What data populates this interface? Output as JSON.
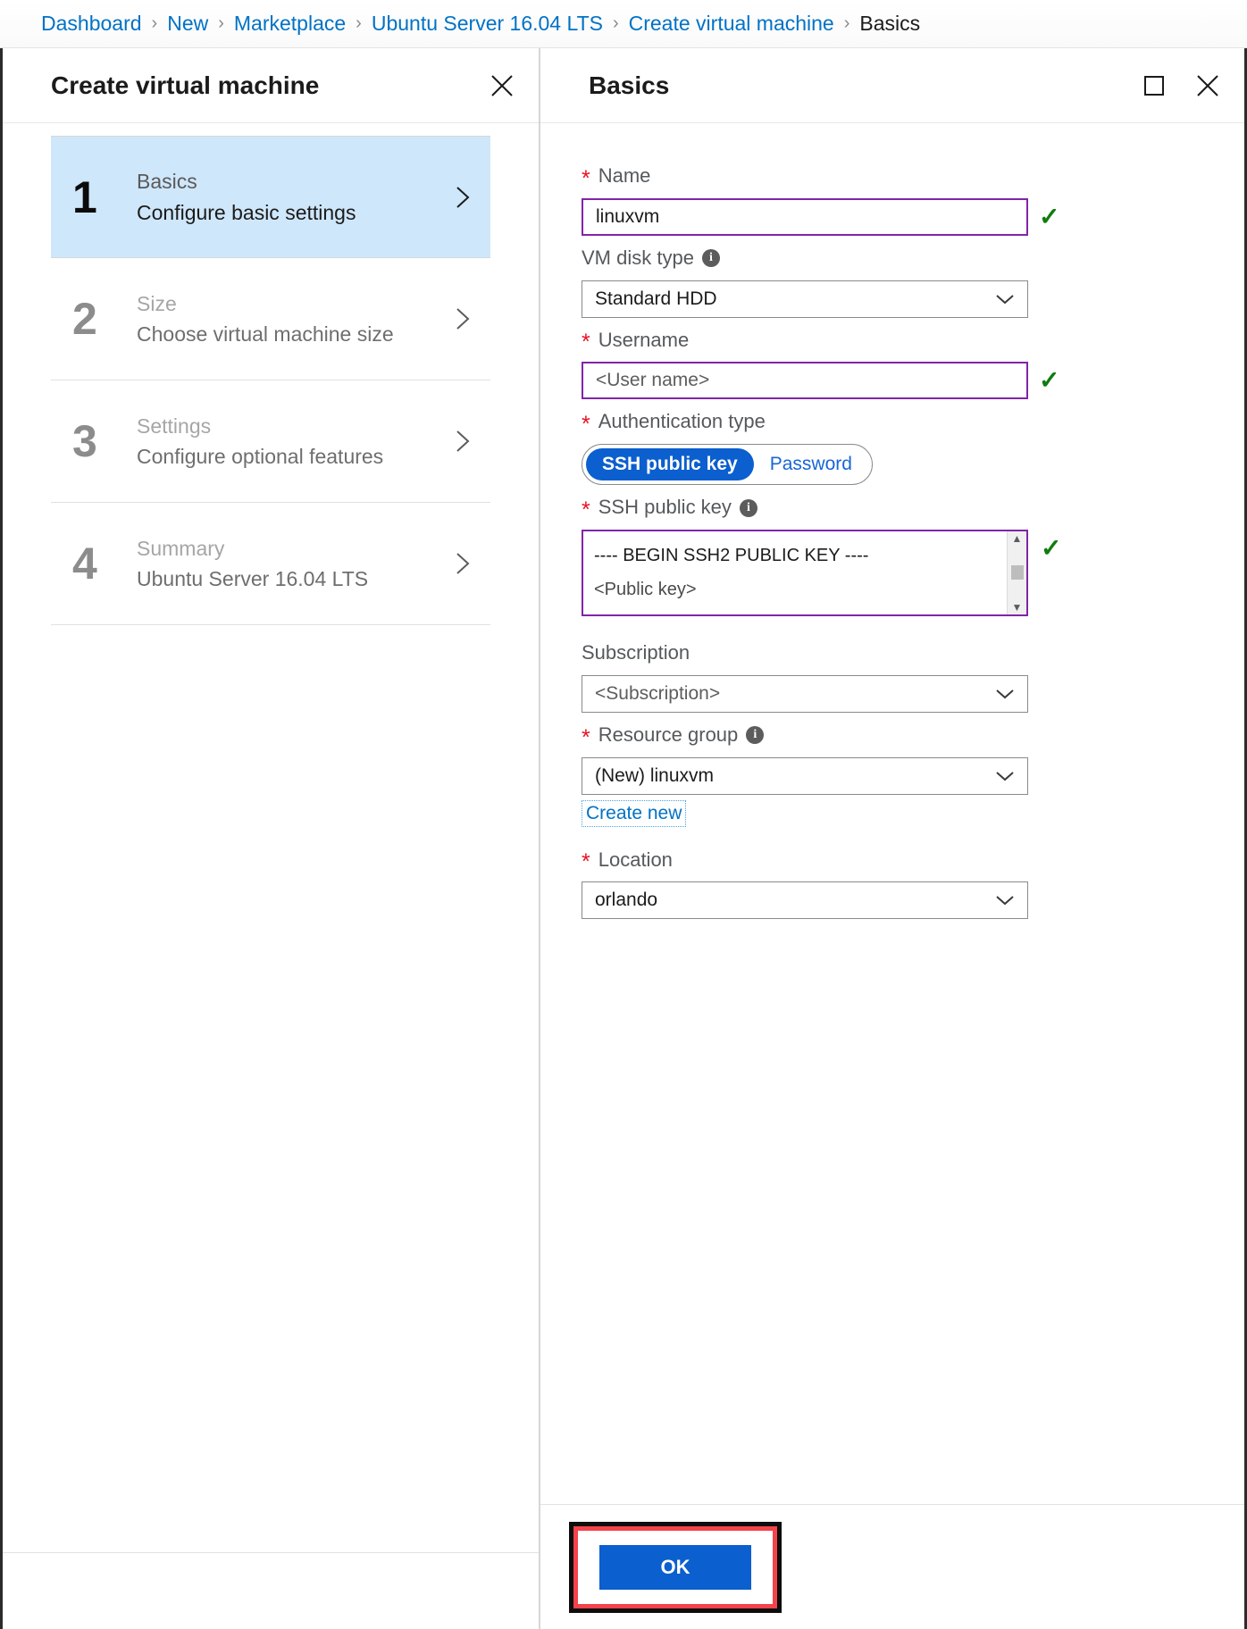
{
  "breadcrumb": {
    "items": [
      {
        "label": "Dashboard",
        "current": false
      },
      {
        "label": "New",
        "current": false
      },
      {
        "label": "Marketplace",
        "current": false
      },
      {
        "label": "Ubuntu Server 16.04 LTS",
        "current": false
      },
      {
        "label": "Create virtual machine",
        "current": false
      },
      {
        "label": "Basics",
        "current": true
      }
    ],
    "separator": "›"
  },
  "left_blade": {
    "title": "Create virtual machine",
    "close_icon": "close-icon",
    "steps": [
      {
        "number": "1",
        "name": "Basics",
        "desc": "Configure basic settings",
        "active": true
      },
      {
        "number": "2",
        "name": "Size",
        "desc": "Choose virtual machine size",
        "active": false
      },
      {
        "number": "3",
        "name": "Settings",
        "desc": "Configure optional features",
        "active": false
      },
      {
        "number": "4",
        "name": "Summary",
        "desc": "Ubuntu Server 16.04 LTS",
        "active": false
      }
    ]
  },
  "right_blade": {
    "title": "Basics",
    "maximize_icon": "maximize-icon",
    "close_icon": "close-icon",
    "fields": {
      "name": {
        "label": "Name",
        "required": true,
        "value": "linuxvm",
        "valid": true
      },
      "vm_disk_type": {
        "label": "VM disk type",
        "required": false,
        "info": true,
        "value": "Standard HDD"
      },
      "username": {
        "label": "Username",
        "required": true,
        "value": "<User name>",
        "valid": true
      },
      "authentication_type": {
        "label": "Authentication type",
        "required": true,
        "options": [
          "SSH public key",
          "Password"
        ],
        "selected": "SSH public key"
      },
      "ssh_public_key": {
        "label": "SSH public key",
        "required": true,
        "info": true,
        "line1": "---- BEGIN SSH2 PUBLIC KEY ----",
        "line2": "<Public key>",
        "valid": true
      },
      "subscription": {
        "label": "Subscription",
        "required": false,
        "value": "<Subscription>"
      },
      "resource_group": {
        "label": "Resource group",
        "required": true,
        "info": true,
        "value": "(New) linuxvm",
        "create_new_label": "Create new"
      },
      "location": {
        "label": "Location",
        "required": false,
        "value": "orlando"
      }
    },
    "ok_button": "OK"
  },
  "colors": {
    "link": "#0072c6",
    "accent_blue": "#0b5fce",
    "valid_purple": "#8025a8",
    "required_red": "#e81123",
    "check_green": "#107c10",
    "highlight_red": "#f4434a",
    "step_active_bg": "#cfe7fa"
  }
}
